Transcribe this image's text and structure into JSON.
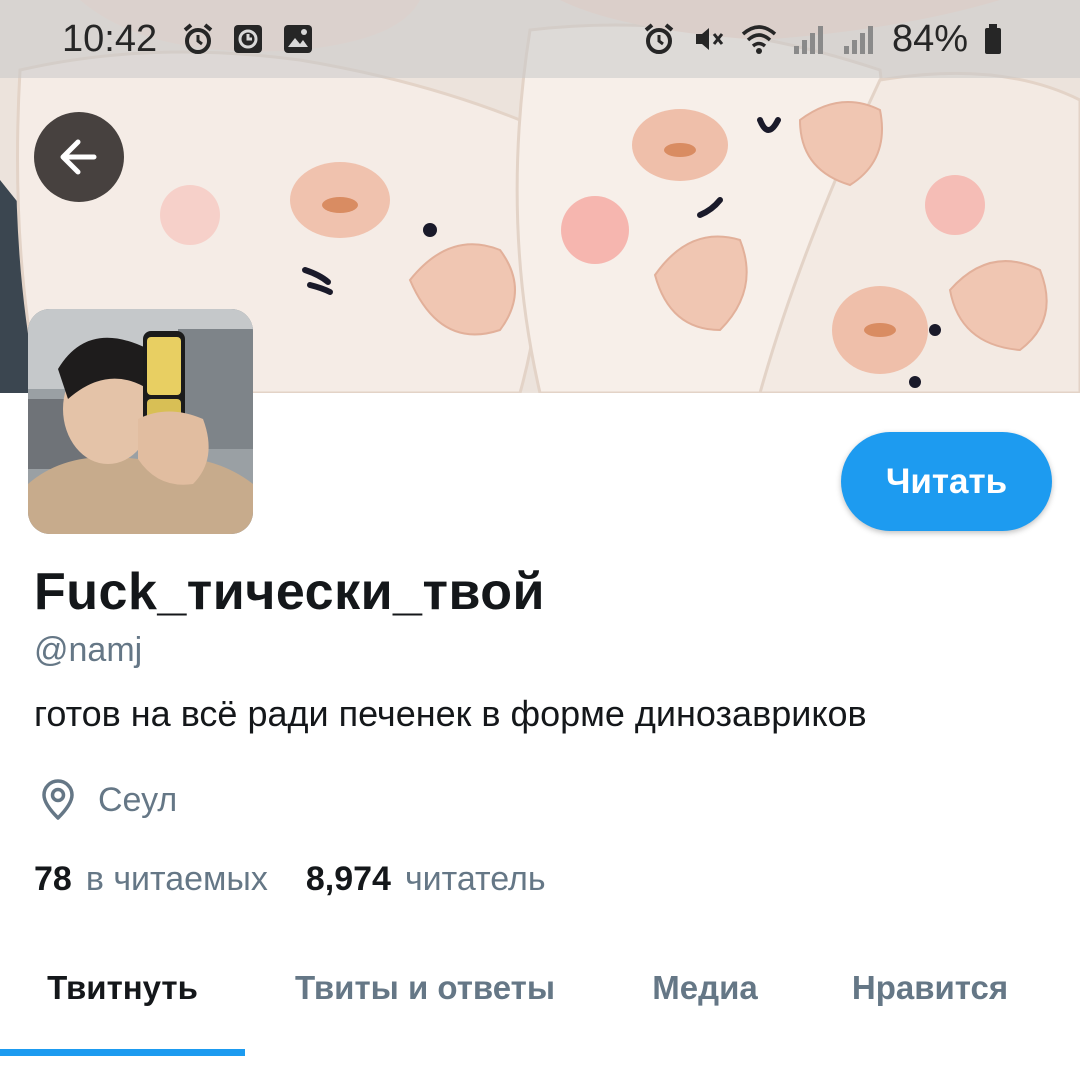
{
  "status_bar": {
    "time": "10:42",
    "battery": "84%",
    "left_icons": [
      "alarm-icon",
      "clock-icon",
      "gallery-icon"
    ],
    "right_icons": [
      "alarm-icon",
      "mute-icon",
      "wifi-icon",
      "signal-icon",
      "signal-icon",
      "battery-icon"
    ]
  },
  "profile": {
    "display_name": "Fuck_тически_твой",
    "handle": "@namj",
    "bio": "готов на всё ради печенек  в форме динозавриков",
    "location": "Сеул",
    "following_count": "78",
    "following_label": "в читаемых",
    "followers_count": "8,974",
    "followers_label": "читатель"
  },
  "follow_button": {
    "label": "Читать"
  },
  "tabs": [
    {
      "label": "Твитнуть",
      "active": true
    },
    {
      "label": "Твиты и ответы",
      "active": false
    },
    {
      "label": "Медиа",
      "active": false
    },
    {
      "label": "Нравится",
      "active": false
    }
  ],
  "colors": {
    "accent": "#1d9bf0",
    "text_primary": "#14171a",
    "text_secondary": "#657786"
  }
}
